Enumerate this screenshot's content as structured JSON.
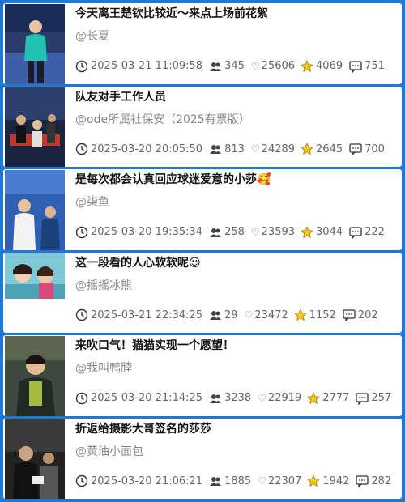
{
  "posts": [
    {
      "title": "今天离王楚钦比较近～来点上场前花絮",
      "author": "@长夏",
      "time": "2025-03-21 11:09:58",
      "views": "345",
      "likes": "25606",
      "stars": "4069",
      "comments": "751"
    },
    {
      "title": "队友对手工作人员",
      "author": "@ode所属社保安（2025有票版）",
      "time": "2025-03-20 20:05:50",
      "views": "813",
      "likes": "24289",
      "stars": "2645",
      "comments": "700"
    },
    {
      "title": "是每次都会认真回应球迷爱意的小莎🥰",
      "author": "@柒鱼",
      "time": "2025-03-20 19:35:34",
      "views": "258",
      "likes": "23593",
      "stars": "3044",
      "comments": "222"
    },
    {
      "title": "这一段看的人心软软呢☺",
      "author": "@摇摇冰熊",
      "time": "2025-03-21 22:34:25",
      "views": "29",
      "likes": "23472",
      "stars": "1152",
      "comments": "202"
    },
    {
      "title": "来吹口气！猫猫实现一个愿望！",
      "author": "@我叫鸭脖",
      "time": "2025-03-20 21:14:25",
      "views": "3238",
      "likes": "22919",
      "stars": "2777",
      "comments": "257"
    },
    {
      "title": "折返给摄影大哥签名的莎莎",
      "author": "@黄油小面包",
      "time": "2025-03-20 21:06:21",
      "views": "1885",
      "likes": "22307",
      "stars": "1942",
      "comments": "282"
    }
  ],
  "icons": {
    "time": "clock-icon",
    "views": "users-icon",
    "likes": "heart-icon",
    "stars": "star-icon",
    "comments": "comment-icon"
  },
  "colors": {
    "background": "#1e78d6",
    "star": "#f5c518"
  }
}
